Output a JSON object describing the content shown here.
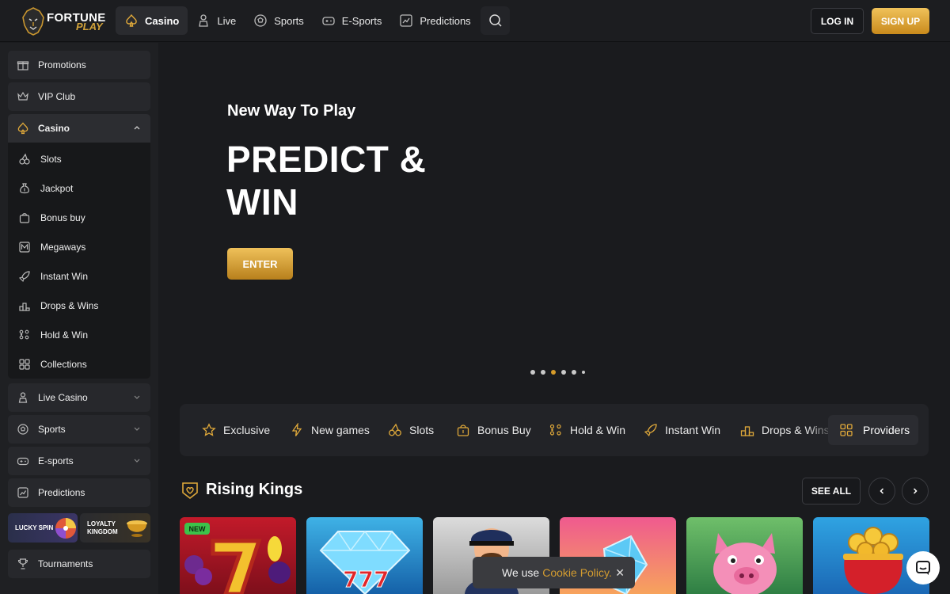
{
  "brand": {
    "name_line1": "FORTUNE",
    "name_line2": "PLAY"
  },
  "topnav": [
    {
      "label": "Casino",
      "icon": "spade-icon",
      "active": true
    },
    {
      "label": "Live",
      "icon": "dealer-icon"
    },
    {
      "label": "Sports",
      "icon": "soccer-ball-icon"
    },
    {
      "label": "E-Sports",
      "icon": "gamepad-icon"
    },
    {
      "label": "Predictions",
      "icon": "chart-icon"
    }
  ],
  "auth": {
    "login": "LOG IN",
    "signup": "SIGN UP"
  },
  "sidebar": {
    "items": [
      {
        "label": "Promotions",
        "icon": "gift-icon"
      },
      {
        "label": "VIP Club",
        "icon": "crown-icon"
      },
      {
        "label": "Casino",
        "icon": "spade-icon",
        "open": true
      },
      {
        "label": "Live Casino",
        "icon": "dealer-icon"
      },
      {
        "label": "Sports",
        "icon": "soccer-ball-icon"
      },
      {
        "label": "E-sports",
        "icon": "gamepad-icon"
      },
      {
        "label": "Predictions",
        "icon": "chart-icon"
      },
      {
        "label": "Tournaments",
        "icon": "trophy-icon"
      }
    ],
    "casino_sub": [
      {
        "label": "Slots",
        "icon": "cherries-icon"
      },
      {
        "label": "Jackpot",
        "icon": "money-bag-icon"
      },
      {
        "label": "Bonus buy",
        "icon": "bonus-bag-icon"
      },
      {
        "label": "Megaways",
        "icon": "megaways-icon"
      },
      {
        "label": "Instant Win",
        "icon": "rocket-icon"
      },
      {
        "label": "Drops & Wins",
        "icon": "podium-icon"
      },
      {
        "label": "Hold & Win",
        "icon": "grid-dots-icon"
      },
      {
        "label": "Collections",
        "icon": "collections-icon"
      }
    ],
    "promos": {
      "lucky": "LUCKY SPIN",
      "loyalty_1": "LOYALTY",
      "loyalty_2": "KINGDOM"
    }
  },
  "hero": {
    "subtitle": "New Way To Play",
    "title_line1": "PREDICT &",
    "title_line2": "WIN",
    "cta": "ENTER",
    "slides": 6,
    "active_slide": 3
  },
  "categories": [
    {
      "label": "Exclusive",
      "icon": "star-icon"
    },
    {
      "label": "New games",
      "icon": "lightning-icon"
    },
    {
      "label": "Slots",
      "icon": "cherries-icon"
    },
    {
      "label": "Bonus Buy",
      "icon": "bonus-bag-icon"
    },
    {
      "label": "Hold & Win",
      "icon": "grid-dots-icon"
    },
    {
      "label": "Instant Win",
      "icon": "rocket-icon"
    },
    {
      "label": "Drops & Wins",
      "icon": "podium-icon"
    }
  ],
  "providers_label": "Providers",
  "section": {
    "title": "Rising Kings",
    "see_all": "SEE ALL",
    "new_badge": "NEW"
  },
  "cookie": {
    "text": "We use",
    "link": "Cookie Policy.",
    "close": "✕"
  },
  "colors": {
    "accent_gold": "#d59b2a",
    "new_badge": "#3cc24a",
    "background": "#1a1b1e"
  }
}
